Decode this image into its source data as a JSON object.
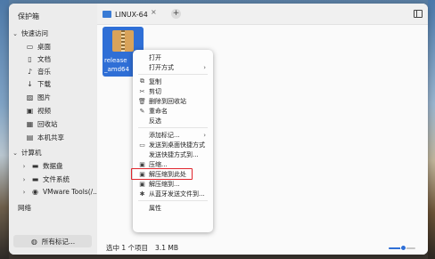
{
  "sidebar": {
    "title": "保护箱",
    "quick_access": {
      "label": "快速访问",
      "items": [
        {
          "label": "桌面",
          "icon": "desktop-icon"
        },
        {
          "label": "文档",
          "icon": "document-icon"
        },
        {
          "label": "音乐",
          "icon": "music-icon"
        },
        {
          "label": "下载",
          "icon": "download-icon"
        },
        {
          "label": "图片",
          "icon": "picture-icon"
        },
        {
          "label": "视频",
          "icon": "video-icon"
        },
        {
          "label": "回收站",
          "icon": "trash-icon"
        },
        {
          "label": "本机共享",
          "icon": "share-icon"
        }
      ]
    },
    "computer": {
      "label": "计算机",
      "items": [
        {
          "label": "数据盘",
          "icon": "drive-icon"
        },
        {
          "label": "文件系统",
          "icon": "filesystem-icon"
        },
        {
          "label": "VMware Tools(/...",
          "icon": "disc-icon",
          "extra": "⏏"
        }
      ]
    },
    "network": {
      "label": "网络"
    },
    "all_tags": "所有标记..."
  },
  "tabbar": {
    "tab_title": "LINUX-64",
    "close_glyph": "×",
    "add_glyph": "+"
  },
  "file": {
    "name_line1": "release",
    "name_line2": "_amd64"
  },
  "context_menu": {
    "items": [
      {
        "label": "打开",
        "icon": "",
        "submenu": false
      },
      {
        "label": "打开方式",
        "icon": "",
        "submenu": true
      },
      {
        "sep": true
      },
      {
        "label": "复制",
        "icon": "⧉",
        "submenu": false
      },
      {
        "label": "剪切",
        "icon": "✂",
        "submenu": false
      },
      {
        "label": "删除到回收站",
        "icon": "🗑",
        "submenu": false
      },
      {
        "label": "重命名",
        "icon": "✎",
        "submenu": false
      },
      {
        "label": "反选",
        "icon": "",
        "submenu": false
      },
      {
        "sep": true
      },
      {
        "label": "添加标记...",
        "icon": "",
        "submenu": true
      },
      {
        "label": "发送到桌面快捷方式",
        "icon": "▭",
        "submenu": false
      },
      {
        "label": "发送快捷方式到...",
        "icon": "",
        "submenu": false
      },
      {
        "label": "压缩...",
        "icon": "▣",
        "submenu": false
      },
      {
        "label": "解压缩到此处",
        "icon": "▣",
        "submenu": false,
        "highlighted": true
      },
      {
        "label": "解压缩到...",
        "icon": "▣",
        "submenu": false
      },
      {
        "label": "从蓝牙发送文件到...",
        "icon": "✱",
        "submenu": false
      },
      {
        "sep": true
      },
      {
        "label": "属性",
        "icon": "",
        "submenu": false
      }
    ]
  },
  "status": {
    "selection": "选中 1 个项目",
    "size": "3.1 MB"
  },
  "zoom": {
    "level": 0.55
  },
  "colors": {
    "accent": "#2f6fd6",
    "highlight_border": "#e0252d"
  }
}
